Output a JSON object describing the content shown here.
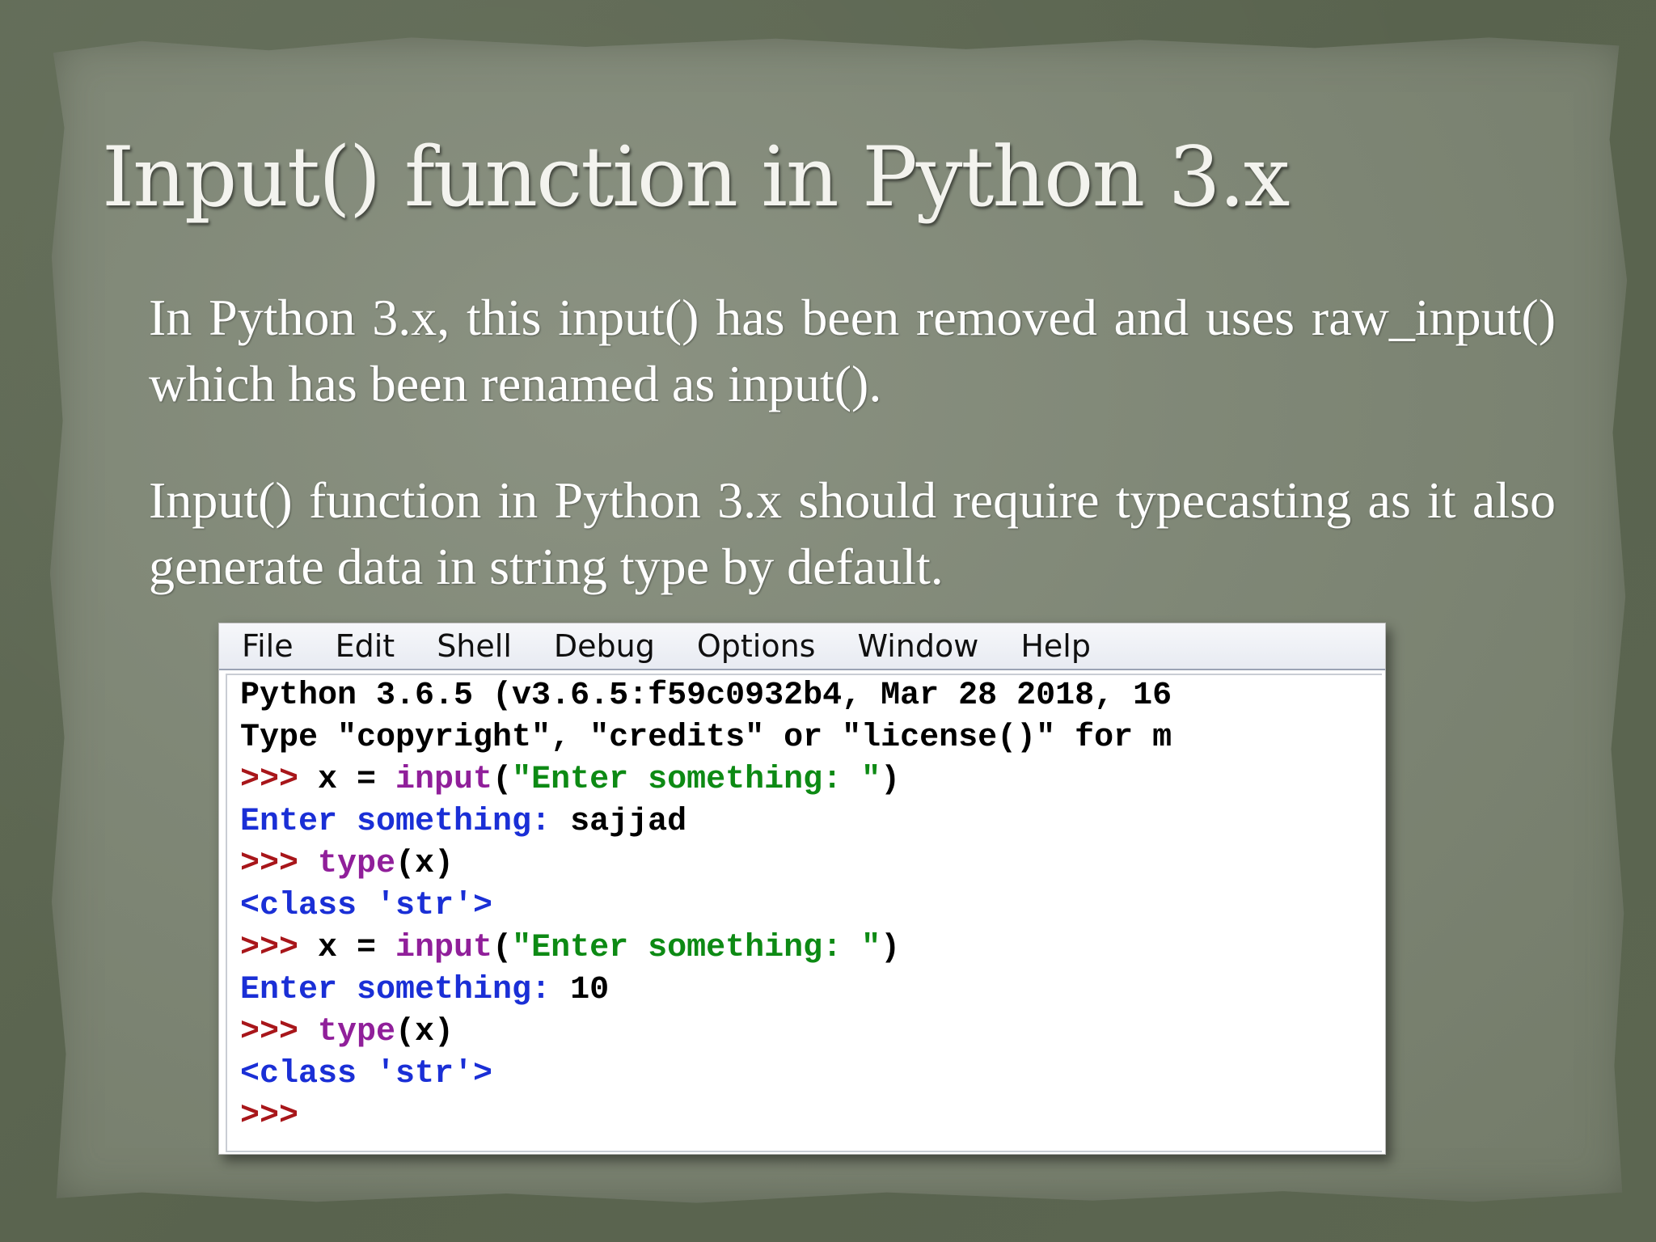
{
  "slide": {
    "title": "Input() function in Python 3.x",
    "paragraphs": [
      "In Python 3.x, this input() has been removed and uses raw_input() which has been renamed as input().",
      "Input() function in Python 3.x should require typecasting as it also generate data in string type by default."
    ]
  },
  "idle_window": {
    "menu": [
      "File",
      "Edit",
      "Shell",
      "Debug",
      "Options",
      "Window",
      "Help"
    ],
    "shell_lines": [
      [
        {
          "text": "Python 3.6.5 (v3.6.5:f59c0932b4, Mar 28 2018, 16",
          "role": "plain"
        }
      ],
      [
        {
          "text": "Type \"copyright\", \"credits\" or \"license()\" for m",
          "role": "plain"
        }
      ],
      [
        {
          "text": ">>> ",
          "role": "prompt"
        },
        {
          "text": "x = ",
          "role": "plain"
        },
        {
          "text": "input",
          "role": "builtin"
        },
        {
          "text": "(",
          "role": "plain"
        },
        {
          "text": "\"Enter something: \"",
          "role": "string"
        },
        {
          "text": ")",
          "role": "plain"
        }
      ],
      [
        {
          "text": "Enter something: ",
          "role": "stdout"
        },
        {
          "text": "sajjad",
          "role": "plain"
        }
      ],
      [
        {
          "text": ">>> ",
          "role": "prompt"
        },
        {
          "text": "type",
          "role": "builtin"
        },
        {
          "text": "(x)",
          "role": "plain"
        }
      ],
      [
        {
          "text": "<class 'str'>",
          "role": "stdout"
        }
      ],
      [
        {
          "text": ">>> ",
          "role": "prompt"
        },
        {
          "text": "x = ",
          "role": "plain"
        },
        {
          "text": "input",
          "role": "builtin"
        },
        {
          "text": "(",
          "role": "plain"
        },
        {
          "text": "\"Enter something: \"",
          "role": "string"
        },
        {
          "text": ")",
          "role": "plain"
        }
      ],
      [
        {
          "text": "Enter something: ",
          "role": "stdout"
        },
        {
          "text": "10",
          "role": "plain"
        }
      ],
      [
        {
          "text": ">>> ",
          "role": "prompt"
        },
        {
          "text": "type",
          "role": "builtin"
        },
        {
          "text": "(x)",
          "role": "plain"
        }
      ],
      [
        {
          "text": "<class 'str'>",
          "role": "stdout"
        }
      ],
      [
        {
          "text": ">>>",
          "role": "prompt"
        }
      ]
    ]
  },
  "colors": {
    "prompt": "#a8161a",
    "builtin": "#901f9a",
    "string": "#0d8a14",
    "stdout": "#1a2fd6",
    "plain": "#000000",
    "title_text": "#f3f3ee",
    "body_text": "#ffffff"
  }
}
